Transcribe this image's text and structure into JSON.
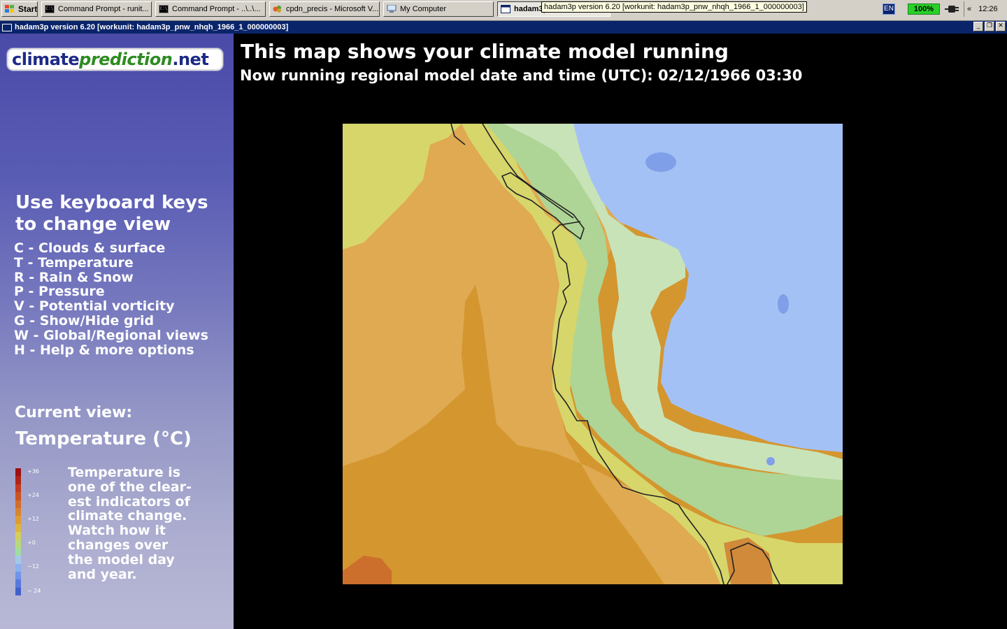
{
  "taskbar": {
    "start_label": "Start",
    "buttons": [
      "Command Prompt - runit...",
      "Command Prompt - ..\\..\\...",
      "cpdn_precis - Microsoft V...",
      "My Computer",
      "hadam3p version 6.20 ..."
    ],
    "tooltip": "hadam3p version 6.20 [workunit: hadam3p_pnw_nhqh_1966_1_000000003]",
    "language": "EN",
    "battery": "100%",
    "tray_expand": "«",
    "clock": "12:26"
  },
  "window": {
    "title": "hadam3p version 6.20 [workunit: hadam3p_pnw_nhqh_1966_1_000000003]",
    "controls": {
      "minimize": "_",
      "restore": "❐",
      "close": "✕"
    }
  },
  "sidebar": {
    "logo": {
      "part1": "climate",
      "part2": "prediction",
      "part3": ".net"
    },
    "keyboard_heading": [
      "Use keyboard keys",
      "to change view"
    ],
    "key_options": [
      "C - Clouds & surface",
      "T - Temperature",
      "R - Rain & Snow",
      "P - Pressure",
      "V - Potential vorticity",
      "G - Show/Hide grid",
      "W - Global/Regional views",
      "H - Help & more options"
    ],
    "current_view_label": "Current view:",
    "current_view_value": "Temperature (°C)",
    "legend_ticks": [
      "+36",
      "+24",
      "+12",
      "+0",
      "−12",
      "− 24"
    ],
    "description": [
      "Temperature is",
      "one of the clear-",
      "est indicators of",
      "climate change.",
      "Watch how it",
      "changes over",
      "the model day",
      "and year."
    ]
  },
  "main": {
    "title": "This map shows your climate model running",
    "subtitle": "Now running regional model date and time (UTC): 02/12/1966 03:30"
  },
  "colors": {
    "ocean_warm": "#d4962f",
    "ocean_mid": "#dfaa52",
    "coast_yellow": "#d7d66b",
    "land_green_dark": "#aed595",
    "land_green_light": "#c9e3b8",
    "land_blue": "#a4c1f6",
    "lake_blue": "#7fa0e8",
    "title_bar": "#0a246a"
  }
}
